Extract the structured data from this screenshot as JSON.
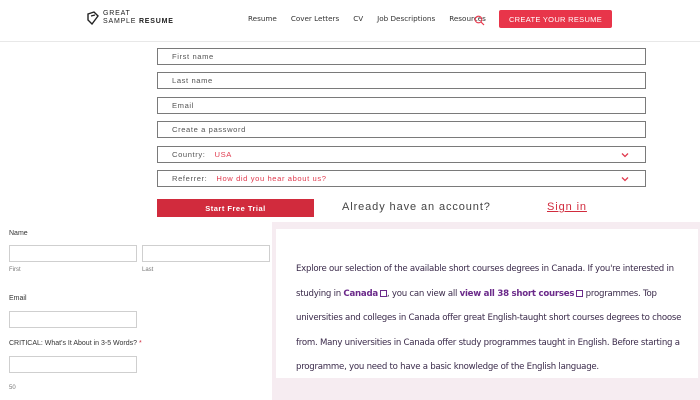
{
  "header": {
    "logo_line1": "GREAT",
    "logo_line2a": "SAMPLE",
    "logo_line2b": "RESUME",
    "nav": [
      "Resume",
      "Cover Letters",
      "CV",
      "Job Descriptions",
      "Resources"
    ],
    "cta_label": "CREATE YOUR RESUME",
    "accent": "#e8354a"
  },
  "signup": {
    "first_name_placeholder": "First name",
    "last_name_placeholder": "Last name",
    "email_placeholder": "Email",
    "password_placeholder": "Create a password",
    "country_label": "Country:",
    "country_value": "USA",
    "referrer_label": "Referrer:",
    "referrer_value": "How did you hear about us?",
    "submit_label": "Start Free Trial",
    "already_text": "Already have an account?",
    "signin_label": "Sign in"
  },
  "contact_form": {
    "name_label": "Name",
    "first_sub": "First",
    "last_sub": "Last",
    "email_label": "Email",
    "critical_label": "CRITICAL: What's It About in 3-5 Words?",
    "required_mark": "*",
    "counter": "50"
  },
  "info_panel": {
    "t1": "Explore our selection of the available short courses degrees in Canada. If you're interested in studying in ",
    "link1": "Canada",
    "t2": ", you can view all ",
    "link2": "view all 38 short courses",
    "t3": " programmes. Top universities and colleges in Canada offer great English-taught short courses degrees to choose from. Many universities in Canada offer study programmes taught in English. Before starting a programme, you need to have a basic knowledge of the English language."
  }
}
